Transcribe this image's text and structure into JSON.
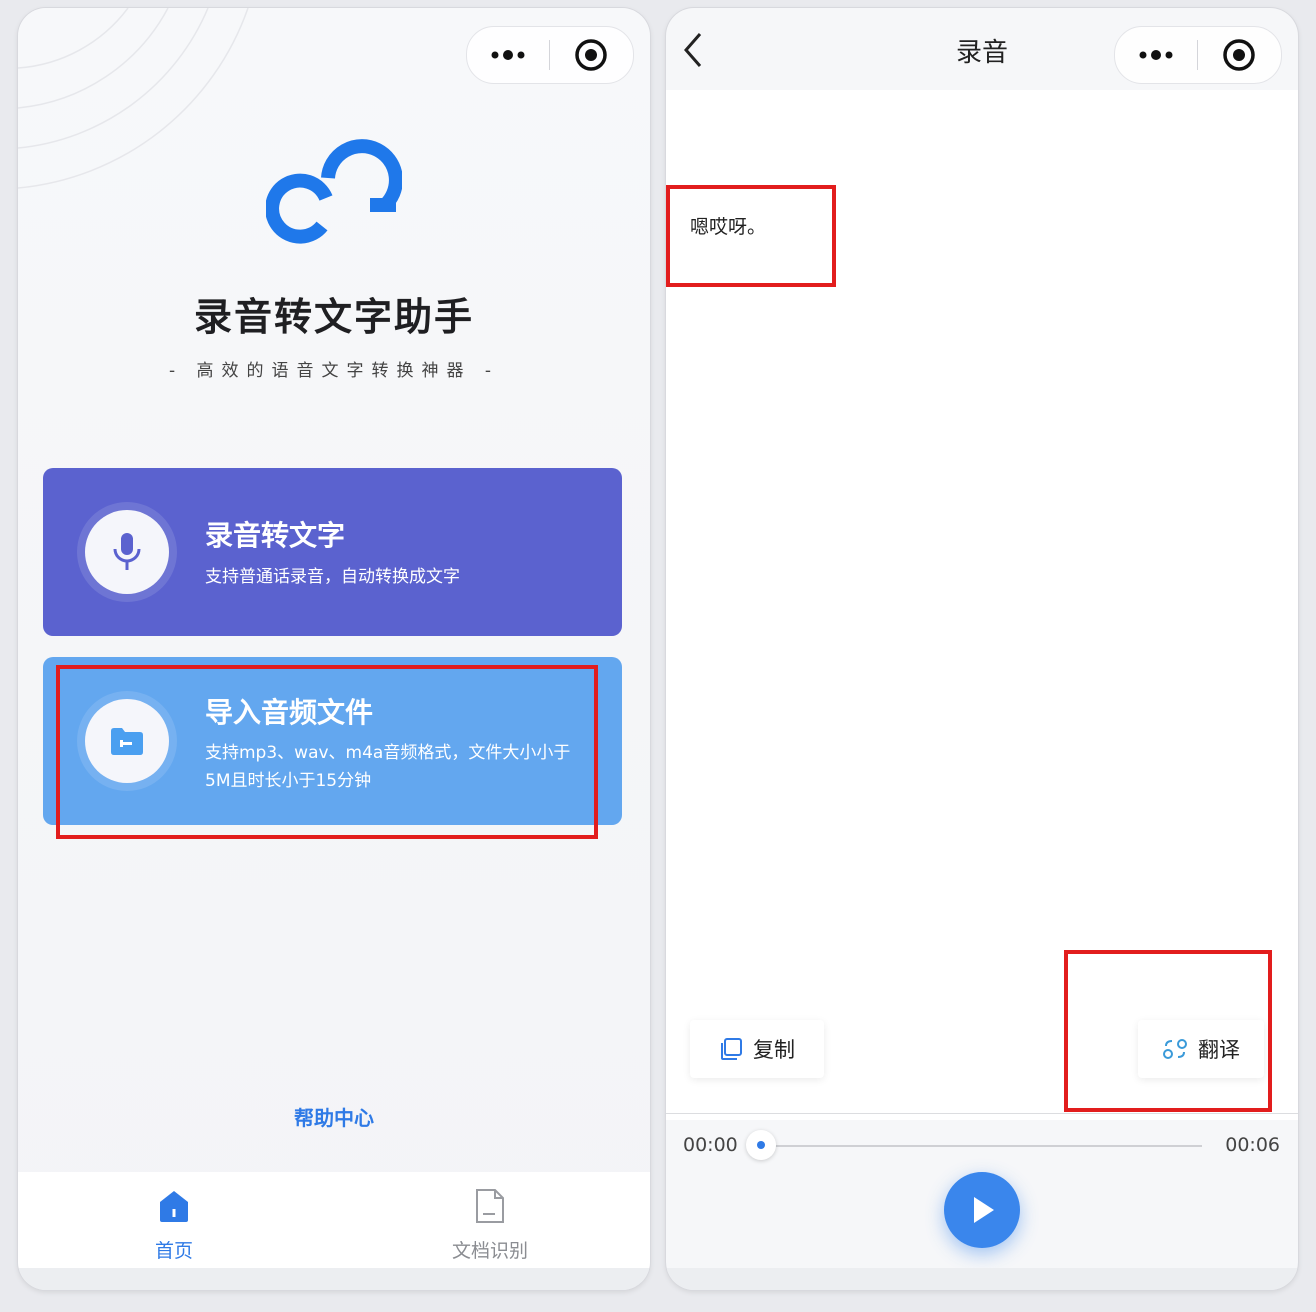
{
  "left": {
    "app_title": "录音转文字助手",
    "app_subtitle": "- 高效的语音文字转换神器 -",
    "record_card": {
      "title": "录音转文字",
      "desc": "支持普通话录音，自动转换成文字"
    },
    "import_card": {
      "title": "导入音频文件",
      "desc": "支持mp3、wav、m4a音频格式，文件大小小于5M且时长小于15分钟"
    },
    "help_link": "帮助中心",
    "tabs": [
      {
        "label": "首页",
        "icon": "home-icon",
        "active": true
      },
      {
        "label": "文档识别",
        "icon": "document-icon",
        "active": false
      }
    ],
    "capsule": {
      "more_icon": "more-dots-icon",
      "close_icon": "target-circle-icon"
    }
  },
  "right": {
    "page_title": "录音",
    "transcript": "嗯哎呀。",
    "copy_label": "复制",
    "translate_label": "翻译",
    "time_start": "00:00",
    "time_end": "00:06",
    "progress": 0.0
  },
  "colors": {
    "accent_blue": "#2f7ae6",
    "record_card": "#5b62cf",
    "import_card": "#63a7ef",
    "highlight_red": "#e21d1d"
  }
}
